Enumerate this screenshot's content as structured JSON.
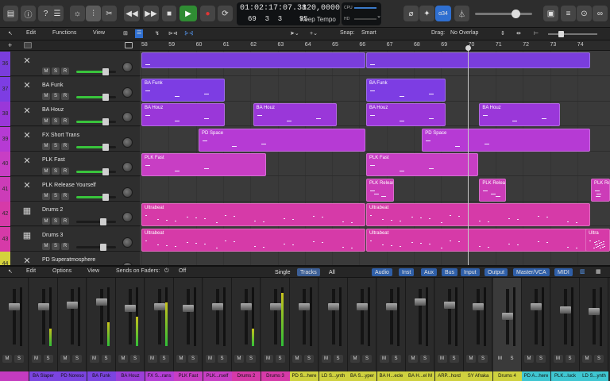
{
  "transport": {
    "time": "01:02:17:07.38",
    "bars": "69  3  3    95",
    "tempo": "120,0000",
    "tempo_label": "Keep Tempo",
    "cpu_label": "CPU",
    "hd_label": "HD",
    "key_badge": "α34"
  },
  "track_menu": {
    "edit": "Edit",
    "functions": "Functions",
    "view": "View",
    "snap_label": "Snap:",
    "snap_value": "Smart",
    "drag_label": "Drag:",
    "drag_value": "No Overlap"
  },
  "ruler": [
    "58",
    "59",
    "60",
    "61",
    "62",
    "63",
    "64",
    "65",
    "66",
    "67",
    "68",
    "69",
    "70",
    "71",
    "72",
    "73",
    "74"
  ],
  "tracks": [
    {
      "num": "36",
      "name": "",
      "color": "#7a3ddc"
    },
    {
      "num": "37",
      "name": "BA Funk",
      "color": "#7d3de3"
    },
    {
      "num": "38",
      "name": "BA Houz",
      "color": "#9a37d9"
    },
    {
      "num": "39",
      "name": "FX Short Trans",
      "color": "#b63ad4"
    },
    {
      "num": "40",
      "name": "PLK Fast",
      "color": "#c83ec4"
    },
    {
      "num": "41",
      "name": "PLK Release Yourself",
      "color": "#cc3cb8"
    },
    {
      "num": "42",
      "name": "Drums 2",
      "color": "#d63aa8"
    },
    {
      "num": "43",
      "name": "Drums 3",
      "color": "#d63aa8"
    },
    {
      "num": "44",
      "name": "PD Superatmosphere",
      "color": "#d4d23c"
    }
  ],
  "regions": {
    "r37a": "BA Funk",
    "r37b": "BA Funk",
    "r38a": "BA Houz",
    "r38b": "BA Houz",
    "r38c": "BA Houz",
    "r38d": "BA Houz",
    "r39a": "PD Space",
    "r39b": "PD Space",
    "r40a": "PLK Fast",
    "r40b": "PLK Fast",
    "r41a": "PLK Releas",
    "r41b": "PLK Relea",
    "r41c": "PLK Re",
    "r42a": "Ultrabeat",
    "r42b": "Ultrabeat",
    "r43a": "Ultrabeat",
    "r43b": "Ultrabeat",
    "r43c": "Ultra"
  },
  "mixer_menu": {
    "edit": "Edit",
    "options": "Options",
    "view": "View",
    "sends": "Sends on Faders:",
    "sends_value": "Off",
    "single": "Single",
    "tracks": "Tracks",
    "all": "All",
    "filters": [
      "Audio",
      "Inst",
      "Aux",
      "Bus",
      "Input",
      "Output",
      "Master/VCA",
      "MIDI"
    ]
  },
  "strips": [
    {
      "label": "",
      "color": "#c43bc0",
      "level": 0
    },
    {
      "label": "BA Slaper",
      "color": "#7b44e0",
      "level": 0.3
    },
    {
      "label": "PD Noreso",
      "color": "#7b44e0",
      "level": 0
    },
    {
      "label": "BA Funk",
      "color": "#7b44e0",
      "level": 0.4
    },
    {
      "label": "BA Houz",
      "color": "#9b3ed8",
      "level": 0.5
    },
    {
      "label": "FX S...rans",
      "color": "#b43ed6",
      "level": 0.75
    },
    {
      "label": "PLK Fast",
      "color": "#c83ec4",
      "level": 0
    },
    {
      "label": "PLK...rself",
      "color": "#c83ec4",
      "level": 0
    },
    {
      "label": "Drums 2",
      "color": "#d63aa8",
      "level": 0.3
    },
    {
      "label": "Drums 3",
      "color": "#d63aa8",
      "level": 0.9
    },
    {
      "label": "PD S...here",
      "color": "#cfd13f",
      "level": 0
    },
    {
      "label": "LD S...ynth",
      "color": "#cfd13f",
      "level": 0
    },
    {
      "label": "BA S...yper",
      "color": "#cfd13f",
      "level": 0
    },
    {
      "label": "BA H...ecle",
      "color": "#cfd13f",
      "level": 0
    },
    {
      "label": "BA H...el M",
      "color": "#cfd13f",
      "level": 0
    },
    {
      "label": "ARP...hord",
      "color": "#cfd13f",
      "level": 0
    },
    {
      "label": "SY Afraka",
      "color": "#cfd13f",
      "level": 0
    },
    {
      "label": "Drums 4",
      "color": "#cfd13f",
      "level": 0
    },
    {
      "label": "PD A...here",
      "color": "#3fc6d1",
      "level": 0
    },
    {
      "label": "PLK...luck",
      "color": "#3fc6d1",
      "level": 0
    },
    {
      "label": "LD S...ynth",
      "color": "#3fc6d1",
      "level": 0
    }
  ],
  "btn": {
    "m": "M",
    "s": "S",
    "r": "R",
    "plus": "+"
  }
}
